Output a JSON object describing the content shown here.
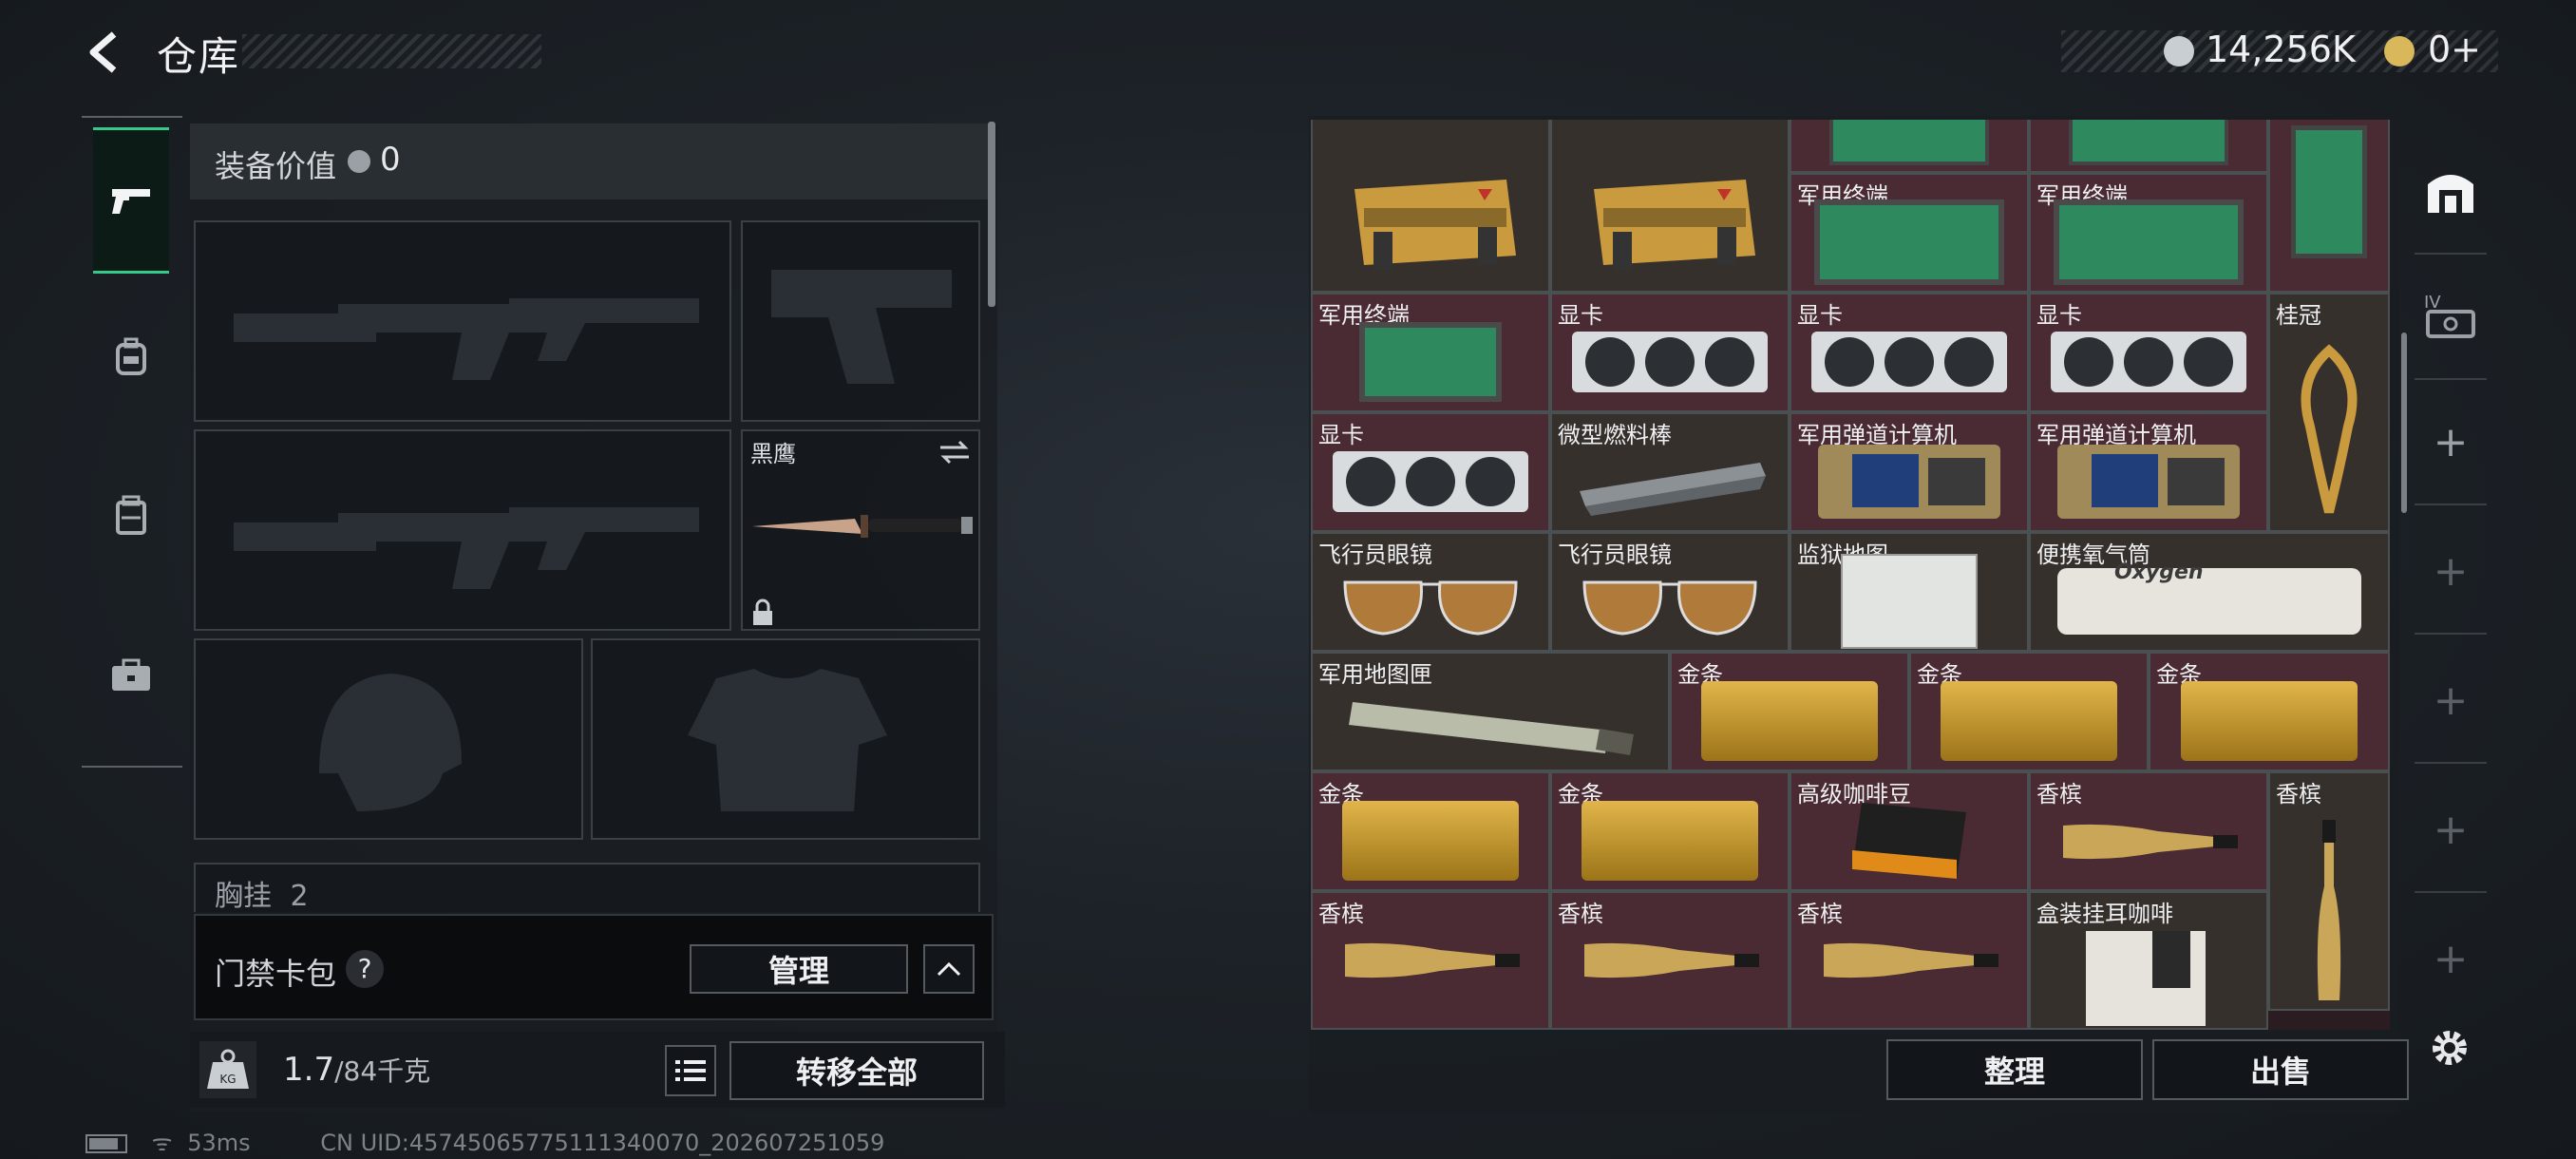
{
  "header": {
    "title": "仓库",
    "currency_value": "14,256K",
    "premium_value": "0+"
  },
  "equipment": {
    "value_label": "装备价值",
    "value": "0",
    "melee_name": "黑鹰",
    "chest_label": "胸挂",
    "chest_count": "2"
  },
  "keycard": {
    "label": "门禁卡包",
    "help": "?",
    "manage_label": "管理"
  },
  "weight": {
    "current": "1.7",
    "max_text": "/84千克"
  },
  "buttons": {
    "transfer_all": "转移全部",
    "sort": "整理",
    "sell": "出售"
  },
  "status": {
    "ping": "53ms",
    "uid": "CN UID:45745065775111340070_202607251059"
  },
  "stash_labels": {
    "terminal": "军用终端",
    "gpu": "显卡",
    "crown": "桂冠",
    "fuel_rod": "微型燃料棒",
    "ballistic_computer": "军用弹道计算机",
    "aviator": "飞行员眼镜",
    "prison_map": "监狱地图",
    "oxygen": "便携氧气筒",
    "map_case": "军用地图匣",
    "gold_bar": "金条",
    "coffee": "高级咖啡豆",
    "champagne": "香槟",
    "boxed_brush": "盒装挂耳咖啡",
    "oxygen_brand": "Oxygen"
  },
  "colors": {
    "accent_green": "#36c98b",
    "item_red": "#4a2a33",
    "item_grey": "#36302d"
  }
}
